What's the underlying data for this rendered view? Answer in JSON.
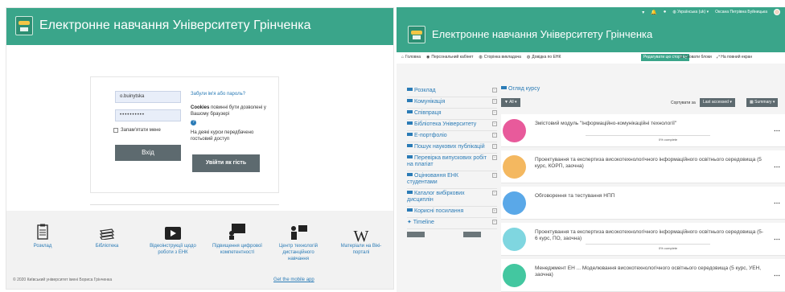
{
  "login_page": {
    "header_title": "Електронне навчання Університету Грінченка",
    "username_value": "o.buinytska",
    "password_value": "••••••••••",
    "remember_label": "Запам'ятати мене",
    "login_button": "Вхід",
    "forgot_link": "Забули ім'я або пароль?",
    "cookies_bold": "Cookies",
    "cookies_text": " повинні бути дозволені у Вашому браузері",
    "help_icon": "question-circle-icon",
    "guest_note": "На деякі курси передбачено гостьовий доступ",
    "guest_button": "Увійти як гість",
    "footer_items": [
      {
        "label": "Розклад",
        "icon": "schedule-icon"
      },
      {
        "label": "Бібліотека",
        "icon": "books-icon"
      },
      {
        "label": "Відеоінструкції щодо роботи з ЕНК",
        "icon": "youtube-icon"
      },
      {
        "label": "Підвищення цифрової компетентності",
        "icon": "presenter-icon"
      },
      {
        "label": "Центр технологій дистанційного навчання",
        "icon": "teacher-icon"
      },
      {
        "label": "Матеріали на Вікі-порталі",
        "icon": "wikipedia-icon"
      }
    ],
    "copyright": "© 2020 Київський університет імені Бориса Грінченка",
    "mobile_link": "Get the mobile app"
  },
  "dashboard": {
    "topbar": {
      "language": "Українська (uk)",
      "user_name": "Оксана Петрівна Буйницька"
    },
    "header_title": "Електронне навчання Університету Грінченка",
    "nav_links": [
      {
        "label": "Головна",
        "icon": "home-icon"
      },
      {
        "label": "Персональний кабінет",
        "icon": "dashboard-icon"
      },
      {
        "label": "Сторінка викладача",
        "icon": "globe-icon"
      },
      {
        "label": "Довідка по ЕНК",
        "icon": "globe-icon"
      }
    ],
    "edit_button": "Редагувати цю сторінку",
    "hide_blocks": "Сховати блоки",
    "fullscreen": "На повний екран",
    "sidebar_items": [
      "Розклад",
      "Комунікація",
      "Співпраця",
      "Бібліотека Університету",
      "Е-портфоліо",
      "Пошук наукових публікацій",
      "Перевірка випускових робіт на плагіат",
      "Оцінювання ЕНК студентами",
      "Каталог вибіркових дисциплін",
      "Корисні посилання",
      "Timeline"
    ],
    "overview_title": "Огляд курсу",
    "filter_button": "All",
    "sort_label": "Сортувати за",
    "sort_button": "Last accessed",
    "view_button": "Summary",
    "courses": [
      {
        "title": "Змістовий модуль \"Інформаційно-комунікаційні технології\"",
        "progress_label": "0% complete",
        "color": "#e85a9b"
      },
      {
        "title": "Проектування та експертиза високотехнологічного інформаційного освітнього середовища (5 курс, КОРП, заочна)",
        "progress_label": "",
        "color": "#f4b860"
      },
      {
        "title": "Обговорення та тестування НПП",
        "progress_label": "",
        "color": "#5aa8e8"
      },
      {
        "title": "Проектування та експертиза високотехнологічного інформаційного освітнього середовища (5-6 курс, ПО, заочна)",
        "progress_label": "0% complete",
        "color": "#7fd6e0"
      },
      {
        "title": "Менеджмент ЕН ... Моделювання високотехнологічного освітнього середовища (5 курс, УЕН, заочна)",
        "progress_label": "",
        "color": "#43c7a0"
      }
    ]
  }
}
